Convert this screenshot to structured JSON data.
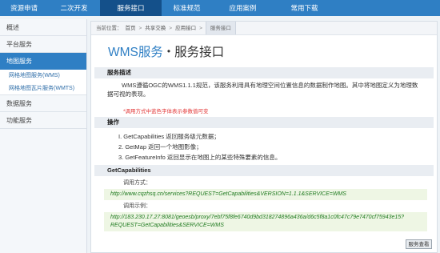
{
  "nav": {
    "items": [
      {
        "label": "资源申请"
      },
      {
        "label": "二次开发"
      },
      {
        "label": "服务接口"
      },
      {
        "label": "标准规范"
      },
      {
        "label": "应用案例"
      },
      {
        "label": "常用下载"
      }
    ],
    "active_index": 2
  },
  "sidebar": {
    "overview": "概述",
    "platform": "平台服务",
    "map_service": "地图服务",
    "wms": "网格地图服务(WMS)",
    "wmts": "网格地图瓦片服务(WMTS)",
    "data": "数据服务",
    "function": "功能服务"
  },
  "breadcrumb": {
    "prefix": "当前位置：",
    "items": [
      "首页",
      "共享交换",
      "应用接口",
      "服务接口"
    ],
    "separator": ">"
  },
  "title": {
    "main": "WMS服务",
    "dot": "•",
    "sub": "服务接口"
  },
  "description": {
    "heading": "服务描述",
    "text": "WMS遵循OGC的WMS1.1.1规范，该服务利用具有地理空间位置信息的数据制作地图。其中将地图定义为地理数据可视的表现。",
    "note": "*调用方式中蓝色字体表示参数值可变"
  },
  "operations": {
    "heading": "操作",
    "items": [
      "I. GetCapabilities 返回服务级元数据；",
      "2. GetMap 返回一个地图影像；",
      "3. GetFeatureInfo 返回显示在地图上的某些特殊要素的信息。"
    ]
  },
  "getcapabilities": {
    "heading": "GetCapabilities",
    "call_label": "调用方式：",
    "call_host": "http://www.cqzhsq.cn",
    "call_path": "/services?REQUEST=GetCapabilities&VERSION=1.1.1&SERVICE=WMS",
    "example_label": "调用示例：",
    "example_url": "http://183.230.17.27:8081/geoesb/proxy/7ebf75f8fe6740d9bd318274896a436a/d6c5f8a1c0fc47c79e7470cf75943e15?REQUEST=GetCapabilities&SERVICE=WMS",
    "view_button": "服务查看"
  }
}
